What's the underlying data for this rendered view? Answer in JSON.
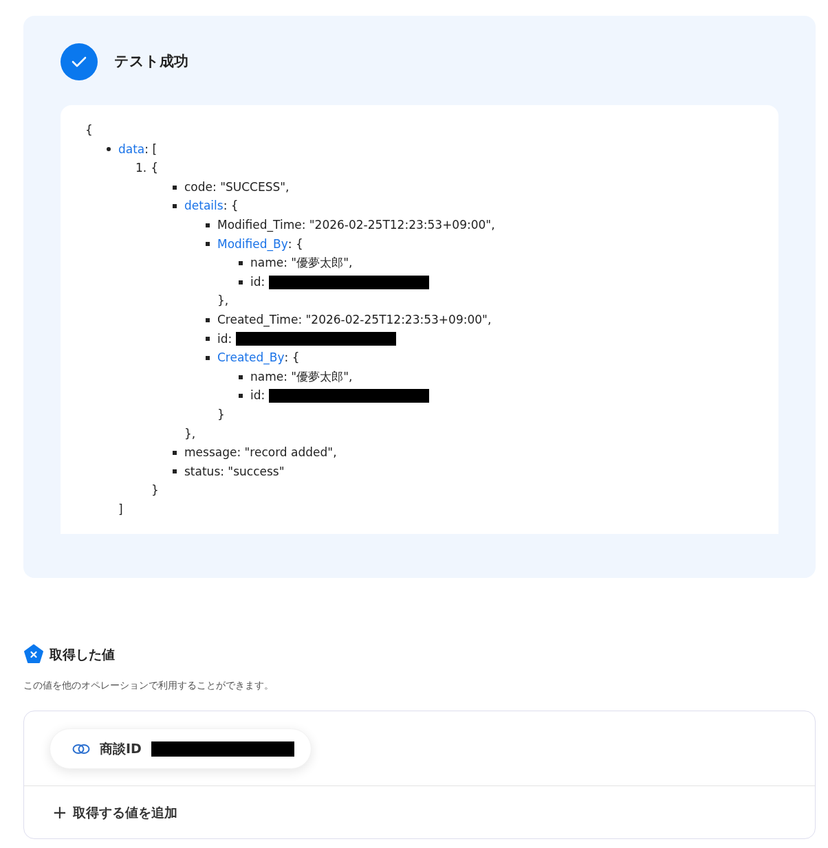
{
  "result_panel": {
    "title": "テスト成功",
    "success": true,
    "json_view": {
      "open": "{",
      "children": [
        {
          "kind": "disc",
          "key": "data",
          "link": true,
          "text": ": [",
          "close": "]",
          "children": [
            {
              "kind": "numbered",
              "number": "1.",
              "text": "{",
              "close": "}",
              "children": [
                {
                  "kind": "square",
                  "key": "code",
                  "link": false,
                  "text": ": \"SUCCESS\","
                },
                {
                  "kind": "square",
                  "key": "details",
                  "link": true,
                  "text": ": {",
                  "close": "},",
                  "children": [
                    {
                      "kind": "square",
                      "key": "Modified_Time",
                      "link": false,
                      "text": ": \"2026-02-25T12:23:53+09:00\","
                    },
                    {
                      "kind": "square",
                      "key": "Modified_By",
                      "link": true,
                      "text": ": {",
                      "close": "},",
                      "children": [
                        {
                          "kind": "square",
                          "key": "name",
                          "link": false,
                          "text": ": \"優夢太郎\","
                        },
                        {
                          "kind": "square",
                          "key": "id",
                          "link": false,
                          "text": ":",
                          "redacted": true
                        }
                      ]
                    },
                    {
                      "kind": "square",
                      "key": "Created_Time",
                      "link": false,
                      "text": ": \"2026-02-25T12:23:53+09:00\","
                    },
                    {
                      "kind": "square",
                      "key": "id",
                      "link": false,
                      "text": ":",
                      "redacted": true
                    },
                    {
                      "kind": "square",
                      "key": "Created_By",
                      "link": true,
                      "text": ": {",
                      "close": "}",
                      "children": [
                        {
                          "kind": "square",
                          "key": "name",
                          "link": false,
                          "text": ": \"優夢太郎\","
                        },
                        {
                          "kind": "square",
                          "key": "id",
                          "link": false,
                          "text": ":",
                          "redacted": true
                        }
                      ]
                    }
                  ]
                },
                {
                  "kind": "square",
                  "key": "message",
                  "link": false,
                  "text": ": \"record added\","
                },
                {
                  "kind": "square",
                  "key": "status",
                  "link": false,
                  "text": ": \"success\""
                }
              ]
            }
          ]
        }
      ]
    }
  },
  "values_section": {
    "title": "取得した値",
    "description": "この値を他のオペレーションで利用することができます。",
    "values": [
      {
        "label": "商談ID",
        "redacted": true
      }
    ],
    "add_button": {
      "icon": "+",
      "label": "取得する値を追加"
    }
  }
}
